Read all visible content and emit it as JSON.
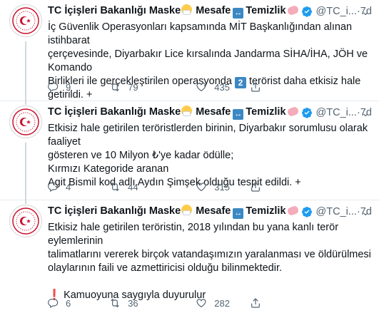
{
  "colors": {
    "accent": "#1d9bf0",
    "muted": "#536471",
    "text": "#0f1419",
    "logo_red": "#c8102e",
    "verified": "#1d9bf0"
  },
  "tweets": [
    {
      "author": {
        "name": "TC İçişleri Bakanlığı Maske",
        "name_part2": "Mesafe",
        "name_part3": "Temizlik",
        "handle": "@TC_i...",
        "dot": "·",
        "time": "7d"
      },
      "lines": [
        "İç Güvenlik Operasyonları kapsamında MİT Başkanlığından alınan istihbarat",
        "çerçevesinde, Diyarbakır Lice kırsalında Jandarma SİHA/İHA, JÖH ve Komando",
        "Birlikleri ile gerçekleştirilen operasyonda",
        "2",
        "terörist daha etkisiz hale",
        "getirildi. +"
      ],
      "stats": {
        "replies": "9",
        "retweets": "79",
        "likes": "435"
      }
    },
    {
      "author": {
        "name": "TC İçişleri Bakanlığı Maske",
        "name_part2": "Mesafe",
        "name_part3": "Temizlik",
        "handle": "@TC_i...",
        "dot": "·",
        "time": "7d"
      },
      "lines": [
        "Etkisiz hale getirilen teröristlerden birinin, Diyarbakır sorumlusu olarak faaliyet",
        "gösteren ve 10 Milyon ₺'ye kadar ödülle;",
        "Kırmızı Kategoride aranan",
        "Agit Bismil kod adlı Aydın Şimşek olduğu tespit edildi. +"
      ],
      "stats": {
        "replies": "4",
        "retweets": "44",
        "likes": "315"
      }
    },
    {
      "author": {
        "name": "TC İçişleri Bakanlığı Maske",
        "name_part2": "Mesafe",
        "name_part3": "Temizlik",
        "handle": "@TC_i...",
        "dot": "·",
        "time": "7d"
      },
      "lines": [
        "Etkisiz hale getirilen teröristin, 2018 yılından bu yana kanlı terör eylemlerinin",
        "talimatlarını vererek birçok vatandaşımızın yaralanması ve öldürülmesi",
        "olaylarının faili ve azmettiricisi olduğu bilinmektedir.",
        "Kamuoyuna saygıyla duyurulur"
      ],
      "stats": {
        "replies": "6",
        "retweets": "36",
        "likes": "282"
      }
    }
  ],
  "icons": {
    "reply": "reply-icon",
    "retweet": "retweet-icon",
    "like": "heart-icon",
    "share": "share-icon",
    "verified": "verified-badge-icon",
    "more": "more-icon",
    "avatar": "ministry-logo-icon"
  }
}
